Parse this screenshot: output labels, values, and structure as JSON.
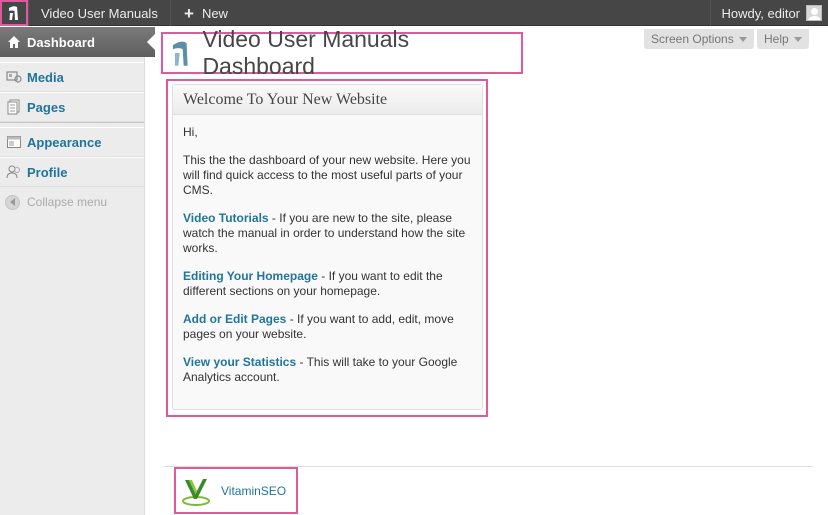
{
  "adminbar": {
    "site_name": "Video User Manuals",
    "new_label": "New",
    "howdy": "Howdy, editor"
  },
  "sidebar": {
    "dashboard": "Dashboard",
    "items": [
      {
        "label": "Media",
        "icon": "media-icon"
      },
      {
        "label": "Pages",
        "icon": "pages-icon"
      },
      {
        "label": "Appearance",
        "icon": "appearance-icon"
      },
      {
        "label": "Profile",
        "icon": "profile-icon"
      }
    ],
    "collapse": "Collapse menu"
  },
  "header": {
    "title": "Video User Manuals Dashboard",
    "screen_options": "Screen Options",
    "help": "Help"
  },
  "welcome": {
    "title": "Welcome To Your New Website",
    "greeting": "Hi,",
    "intro": "This the the dashboard of your new website. Here you will find quick access to the most useful parts of your CMS.",
    "links": [
      {
        "label": "Video Tutorials",
        "text": " - If you are new to the site, please watch the manual in order to understand how the site works."
      },
      {
        "label": "Editing Your Homepage",
        "text": " - If you want to edit the different sections on your homepage."
      },
      {
        "label": "Add or Edit Pages",
        "text": " - If you want to add, edit, move pages on your website."
      },
      {
        "label": "View your Statistics",
        "text": " - This will take to your Google Analytics account."
      }
    ]
  },
  "footer": {
    "brand": "VitaminSEO"
  },
  "colors": {
    "highlight": "#e0599e",
    "link": "#21759b",
    "adminbar": "#464646"
  }
}
